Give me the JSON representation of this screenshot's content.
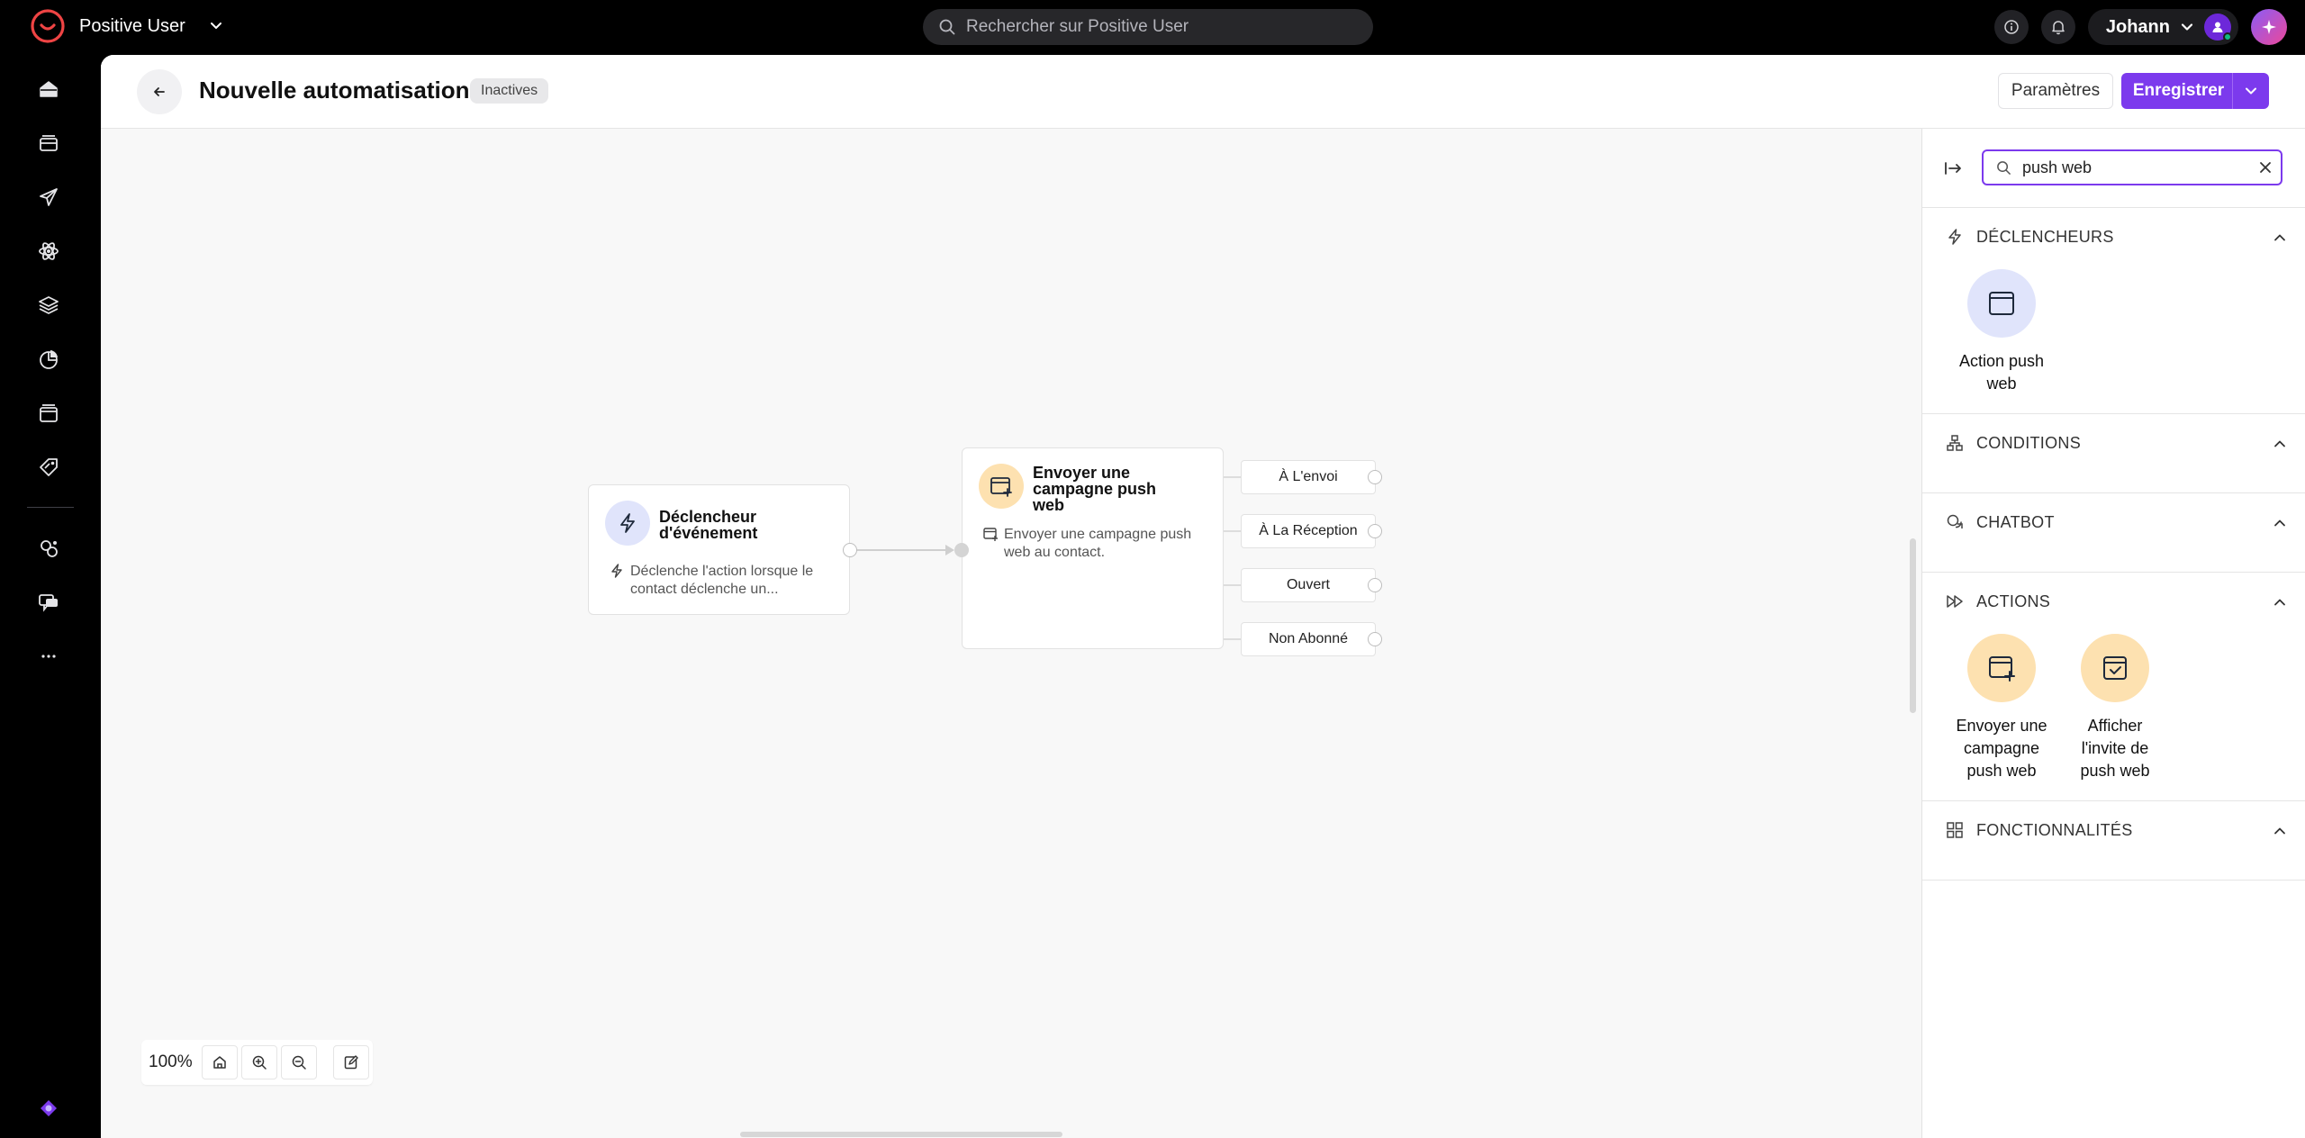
{
  "app": {
    "name": "Positive User"
  },
  "search": {
    "placeholder": "Rechercher sur Positive User"
  },
  "user": {
    "name": "Johann"
  },
  "header": {
    "title": "Nouvelle automatisation",
    "status": "Inactives",
    "params_label": "Paramètres",
    "save_label": "Enregistrer"
  },
  "colors": {
    "accent": "#7c3aed",
    "trigger_bg": "#e0e4fb",
    "action_bg": "#fde1b0"
  },
  "canvas": {
    "trigger_node": {
      "title_line1": "Déclencheur",
      "title_line2": "d'événement",
      "desc_line1": "Déclenche l'action lorsque le",
      "desc_line2": "contact déclenche un...",
      "icon": "lightning-icon"
    },
    "action_node": {
      "title_line1": "Envoyer une",
      "title_line2": "campagne push",
      "title_line3": "web",
      "desc_line1": "Envoyer une campagne push",
      "desc_line2": "web au contact.",
      "icon": "browser-plus-icon"
    },
    "outlets": [
      "À L'envoi",
      "À La Réception",
      "Ouvert",
      "Non Abonné"
    ],
    "zoom": "100%"
  },
  "panel": {
    "search_value": "push web",
    "sections": [
      {
        "title": "DÉCLENCHEURS",
        "icon": "lightning-icon",
        "items": [
          {
            "line1": "Action push",
            "line2": "web"
          }
        ]
      },
      {
        "title": "CONDITIONS",
        "icon": "hierarchy-icon"
      },
      {
        "title": "CHATBOT",
        "icon": "chat-bubbles-icon"
      },
      {
        "title": "ACTIONS",
        "icon": "fast-forward-icon",
        "items": [
          {
            "line1": "Envoyer une",
            "line2": "campagne",
            "line3": "push web"
          },
          {
            "line1": "Afficher",
            "line2": "l'invite de",
            "line3": "push web"
          }
        ]
      },
      {
        "title": "FONCTIONNALITÉS",
        "icon": "grid-icon"
      }
    ]
  },
  "nav": [
    "dashboard-icon",
    "contacts-icon",
    "campaigns-icon",
    "automation-icon",
    "layers-icon",
    "analytics-icon",
    "templates-icon",
    "tags-icon",
    "integrations-icon",
    "chat-icon",
    "more-icon",
    "help-icon"
  ]
}
